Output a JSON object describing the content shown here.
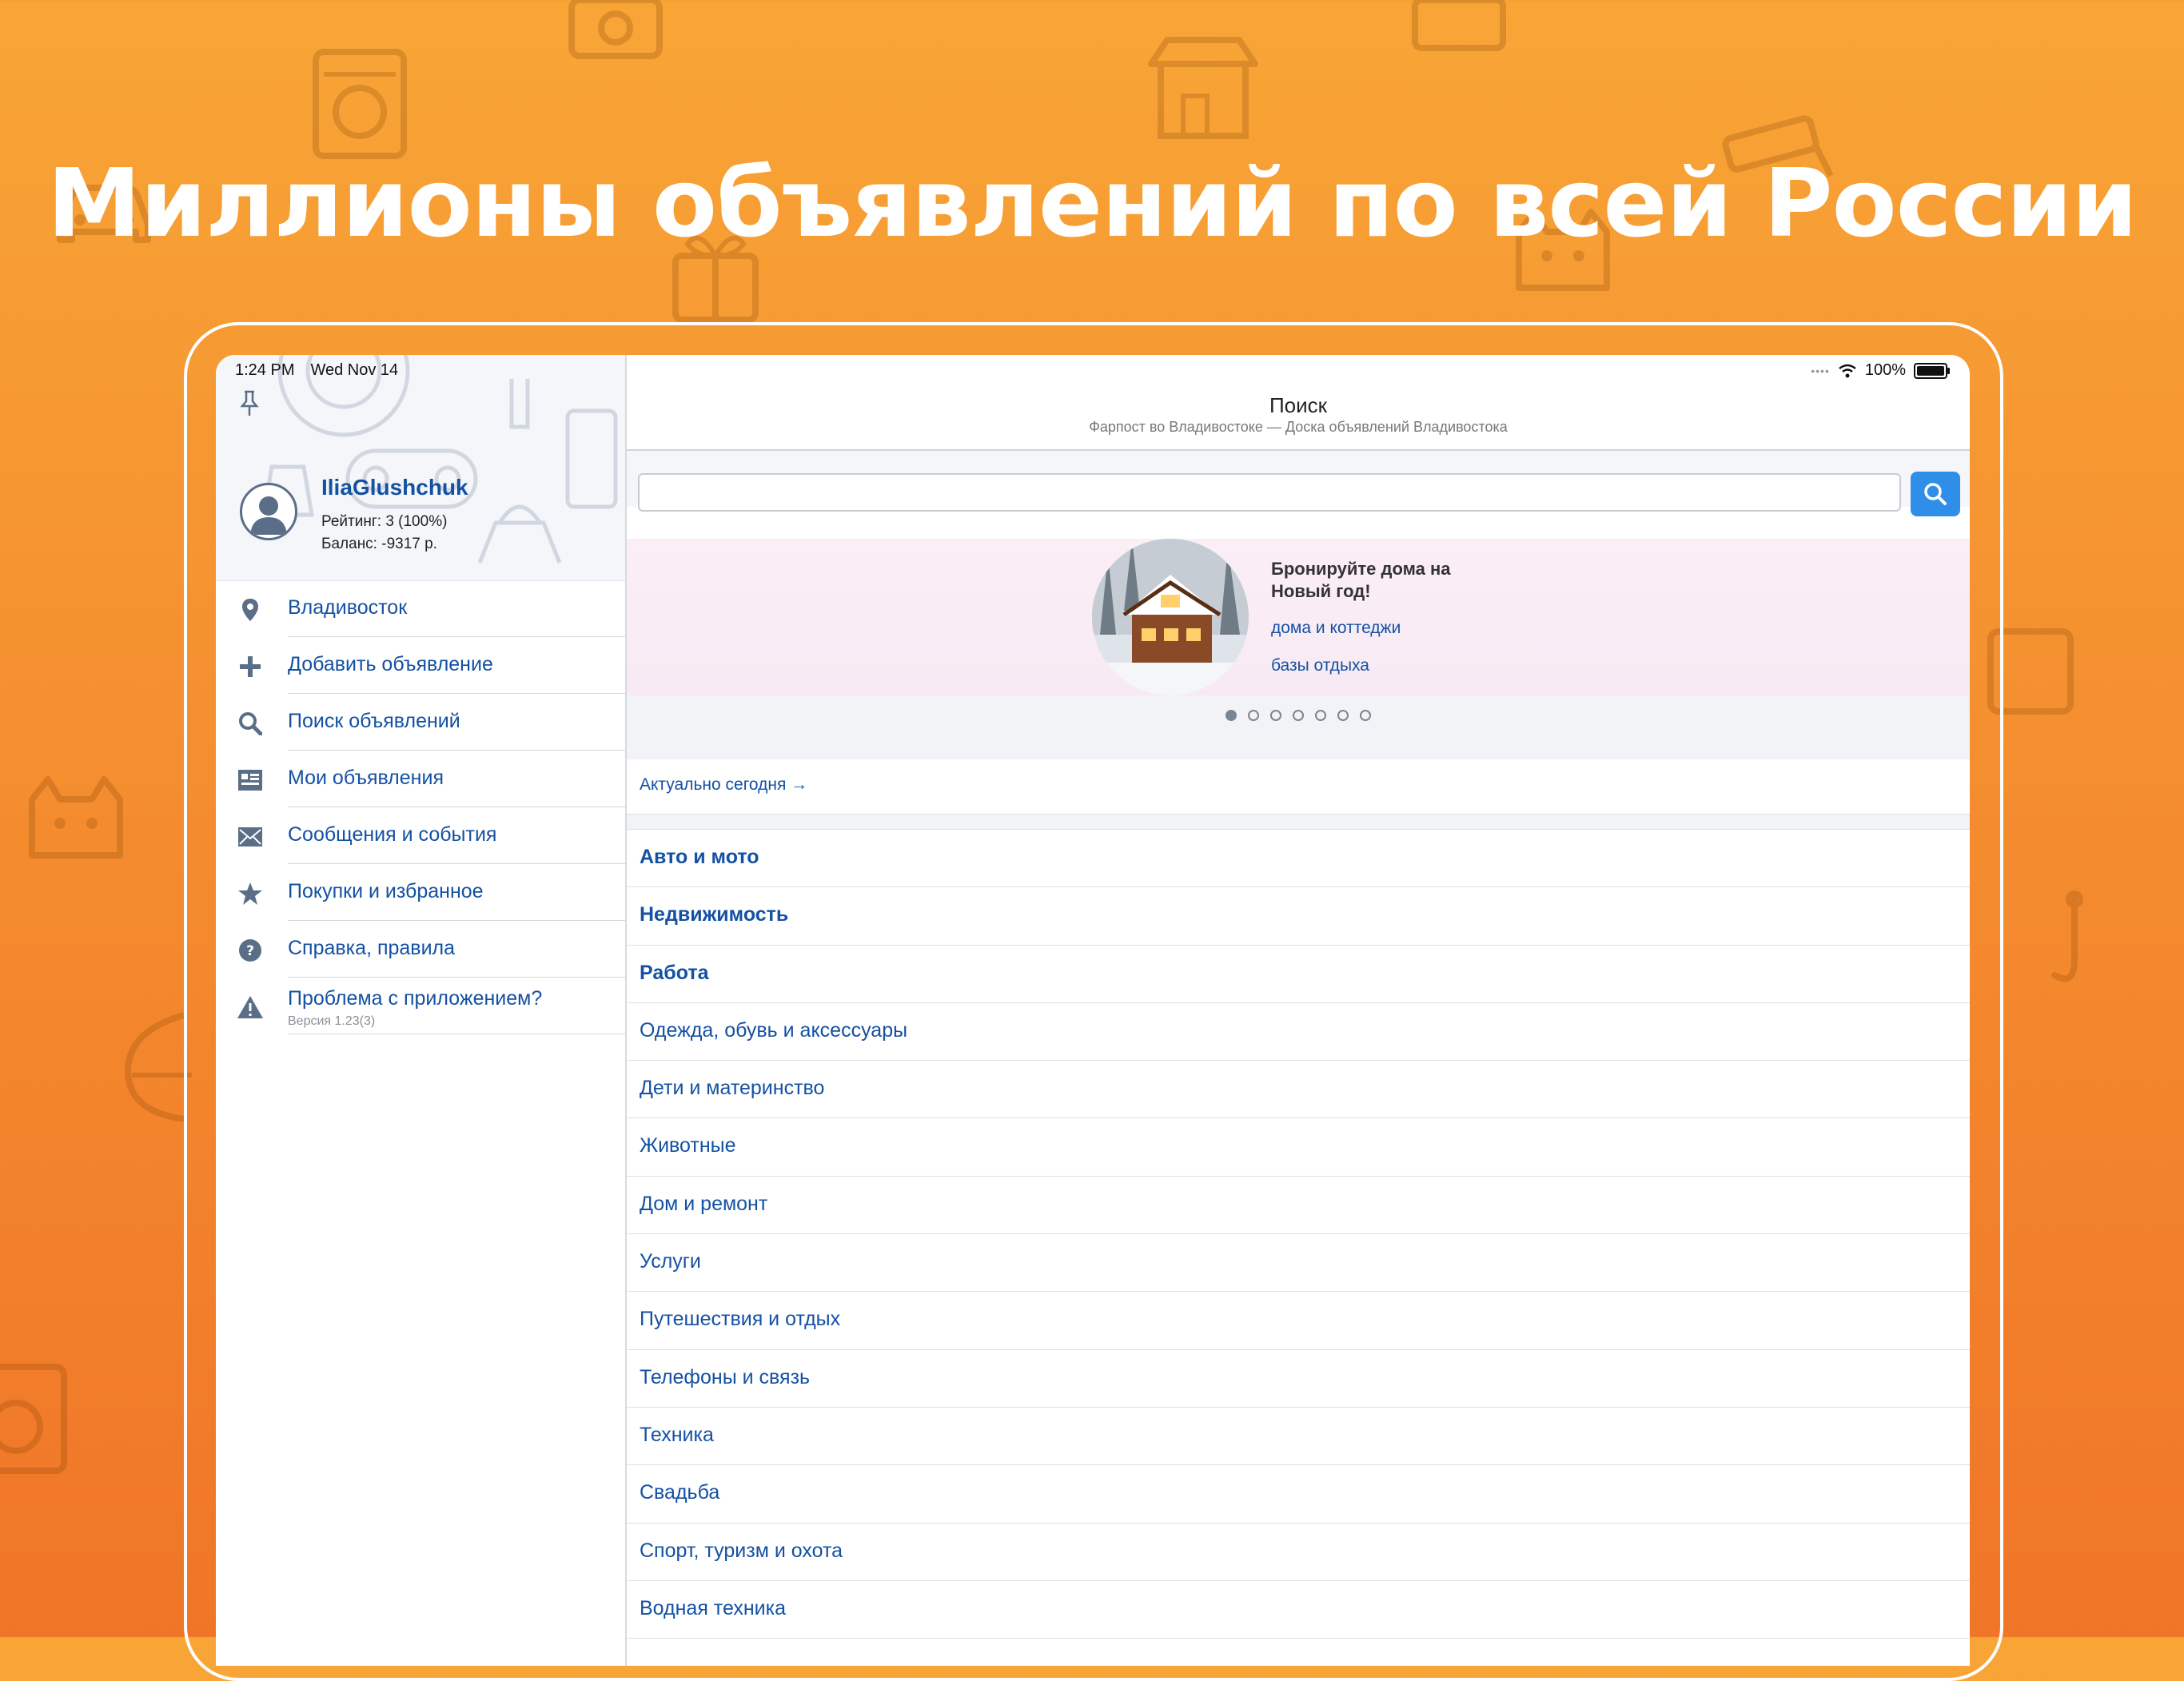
{
  "headline": "Миллионы объявлений по всей России",
  "status_bar": {
    "time": "1:24 PM",
    "date": "Wed Nov 14",
    "battery": "100%"
  },
  "profile": {
    "username": "IliaGlushchuk",
    "rating": "Рейтинг: 3 (100%)",
    "balance": "Баланс: -9317 р."
  },
  "menu": [
    {
      "label": "Владивосток",
      "icon": "location-pin-icon"
    },
    {
      "label": "Добавить объявление",
      "icon": "plus-icon"
    },
    {
      "label": "Поиск объявлений",
      "icon": "search-icon"
    },
    {
      "label": "Мои объявления",
      "icon": "ads-list-icon"
    },
    {
      "label": "Сообщения и события",
      "icon": "envelope-icon"
    },
    {
      "label": "Покупки и избранное",
      "icon": "star-icon"
    },
    {
      "label": "Справка, правила",
      "icon": "help-icon"
    },
    {
      "label": "Проблема с приложением?",
      "icon": "warning-icon",
      "sub": "Версия 1.23(3)"
    }
  ],
  "nav": {
    "title": "Поиск",
    "subtitle": "Фарпост во Владивостоке — Доска объявлений Владивостока"
  },
  "search": {
    "placeholder": ""
  },
  "banner": {
    "title": "Бронируйте дома на Новый год!",
    "link1": "дома и коттеджи",
    "link2": "базы отдыха",
    "page_count": 7,
    "active_page": 1
  },
  "today_link": "Актуально сегодня →",
  "categories": [
    {
      "label": "Авто и мото",
      "bold": true
    },
    {
      "label": "Недвижимость",
      "bold": true
    },
    {
      "label": "Работа",
      "bold": true
    },
    {
      "label": "Одежда, обувь и аксессуары",
      "bold": false
    },
    {
      "label": "Дети и материнство",
      "bold": false
    },
    {
      "label": "Животные",
      "bold": false
    },
    {
      "label": "Дом и ремонт",
      "bold": false
    },
    {
      "label": "Услуги",
      "bold": false
    },
    {
      "label": "Путешествия и отдых",
      "bold": false
    },
    {
      "label": "Телефоны и связь",
      "bold": false
    },
    {
      "label": "Техника",
      "bold": false
    },
    {
      "label": "Свадьба",
      "bold": false
    },
    {
      "label": "Спорт, туризм и охота",
      "bold": false
    },
    {
      "label": "Водная техника",
      "bold": false
    }
  ],
  "colors": {
    "accent": "#1451a3",
    "search_button": "#2f8ee8",
    "background_top": "#f8a536",
    "background_bottom": "#f07528"
  }
}
